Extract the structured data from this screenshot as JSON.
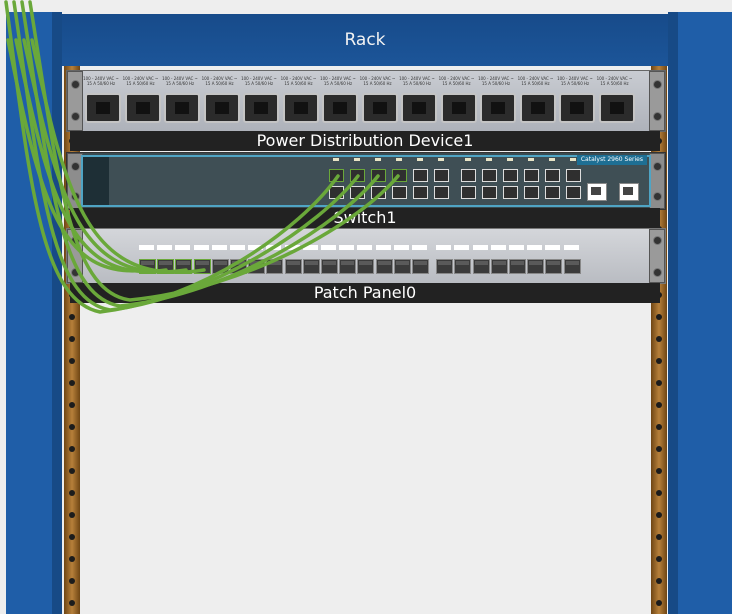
{
  "rack": {
    "title": "Rack"
  },
  "devices": {
    "pdu": {
      "label": "Power Distribution Device1",
      "outlet_count": 14,
      "outlet_text": "100 - 240V VAC ~ 15 A 50/60 Hz"
    },
    "switch": {
      "label": "Switch1",
      "model_badge": "Catalyst 2960 Series",
      "port_count": 24,
      "connected_ports": 4
    },
    "patch_panel": {
      "label": "Patch Panel0",
      "jack_count": 24,
      "connected_jacks": 4
    }
  },
  "colors": {
    "rack_post": "#1f5ea8",
    "cable": "#6aa83a",
    "rail": "#b7803a",
    "label_bar": "#222222",
    "switch_trim": "#4fa4c4"
  }
}
